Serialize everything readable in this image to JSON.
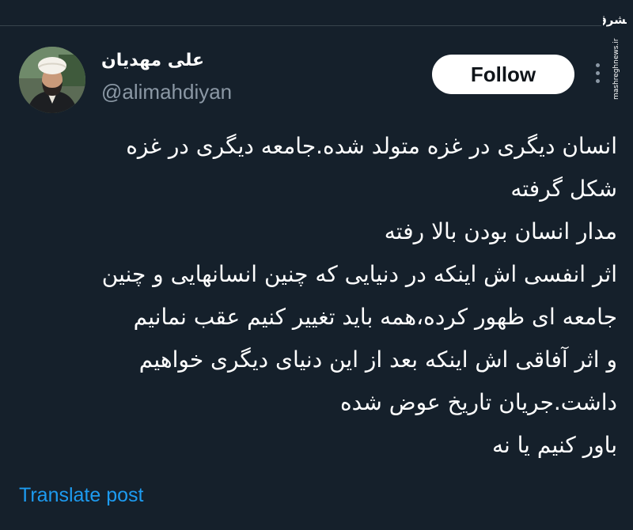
{
  "watermark": {
    "brand": "مشرق",
    "url": "mashreghnews.ir"
  },
  "author": {
    "display_name": "علی مهدیان",
    "handle": "@alimahdiyan",
    "avatar_icon": "user-avatar"
  },
  "actions": {
    "follow_label": "Follow",
    "more_icon": "more-dots-icon"
  },
  "tweet": {
    "lines": [
      "انسان دیگری در غزه متولد شده.جامعه دیگری در غزه",
      "شکل گرفته",
      "مدار انسان بودن بالا رفته",
      "اثر انفسی اش اینکه در دنیایی که چنین انسانهایی و چنین",
      "جامعه ای ظهور کرده،همه باید تغییر کنیم عقب نمانیم",
      "و اثر آفاقی اش اینکه بعد از این دنیای دیگری خواهیم",
      "داشت.جریان تاریخ عوض شده",
      "باور کنیم یا نه"
    ]
  },
  "translate_label": "Translate post",
  "colors": {
    "background": "#15202b",
    "muted_text": "#8b98a5",
    "link": "#1d9bf0",
    "button_bg": "#ffffff"
  }
}
